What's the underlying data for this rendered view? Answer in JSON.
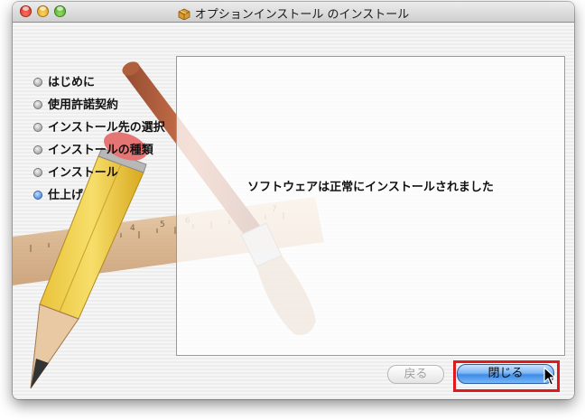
{
  "window": {
    "title": "オプションインストール のインストール"
  },
  "sidebar": {
    "steps": [
      {
        "label": "はじめに",
        "state": "inactive"
      },
      {
        "label": "使用許諾契約",
        "state": "inactive"
      },
      {
        "label": "インストール先の選択",
        "state": "inactive"
      },
      {
        "label": "インストールの種類",
        "state": "inactive"
      },
      {
        "label": "インストール",
        "state": "inactive"
      },
      {
        "label": "仕上げ",
        "state": "active"
      }
    ]
  },
  "main": {
    "message": "ソフトウェアは正常にインストールされました"
  },
  "buttons": {
    "back_label": "戻る",
    "back_enabled": false,
    "close_label": "閉じる"
  },
  "ruler": {
    "marks": [
      "6",
      "7",
      "4",
      "5"
    ]
  },
  "colors": {
    "highlight": "#e0191f",
    "primary_button": "#3f8ae6"
  }
}
